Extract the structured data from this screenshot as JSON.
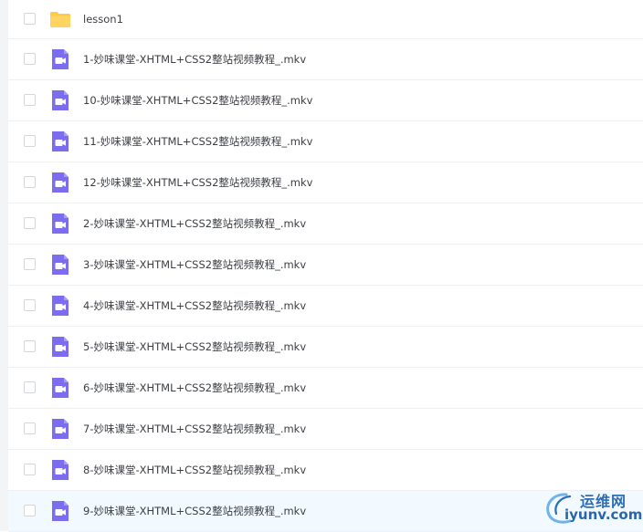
{
  "file_list": {
    "rows": [
      {
        "name": "lesson1",
        "type": "folder"
      },
      {
        "name": "1-妙味课堂-XHTML+CSS2整站视频教程_.mkv",
        "type": "video"
      },
      {
        "name": "10-妙味课堂-XHTML+CSS2整站视频教程_.mkv",
        "type": "video"
      },
      {
        "name": "11-妙味课堂-XHTML+CSS2整站视频教程_.mkv",
        "type": "video"
      },
      {
        "name": "12-妙味课堂-XHTML+CSS2整站视频教程_.mkv",
        "type": "video"
      },
      {
        "name": "2-妙味课堂-XHTML+CSS2整站视频教程_.mkv",
        "type": "video"
      },
      {
        "name": "3-妙味课堂-XHTML+CSS2整站视频教程_.mkv",
        "type": "video"
      },
      {
        "name": "4-妙味课堂-XHTML+CSS2整站视频教程_.mkv",
        "type": "video"
      },
      {
        "name": "5-妙味课堂-XHTML+CSS2整站视频教程_.mkv",
        "type": "video"
      },
      {
        "name": "6-妙味课堂-XHTML+CSS2整站视频教程_.mkv",
        "type": "video"
      },
      {
        "name": "7-妙味课堂-XHTML+CSS2整站视频教程_.mkv",
        "type": "video"
      },
      {
        "name": "8-妙味课堂-XHTML+CSS2整站视频教程_.mkv",
        "type": "video"
      },
      {
        "name": "9-妙味课堂-XHTML+CSS2整站视频教程_.mkv",
        "type": "video"
      }
    ]
  },
  "watermark": {
    "brand": "运维网",
    "domain": "iyunv.com"
  },
  "colors": {
    "folder": "#ffc94a",
    "video_icon": "#7b6cf0",
    "hover_row": "#f2f9ff",
    "watermark": "#2f6db5"
  },
  "icons": {
    "folder": "folder-icon",
    "video": "video-file-icon",
    "watermark_logo": "swoosh-logo"
  },
  "hovered_row_index": 12
}
